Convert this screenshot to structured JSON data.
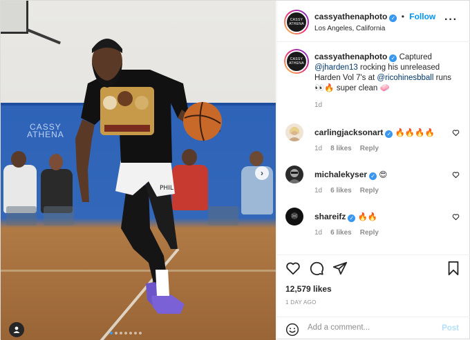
{
  "photo": {
    "watermark_line1": "CASSY",
    "watermark_line2": "ATHENA",
    "shirt_text": "PHIL",
    "carousel_dots": 7,
    "carousel_active_index": 0,
    "next_icon": "chevron-right-icon",
    "tag_icon": "user-tag-icon"
  },
  "header": {
    "avatar_line1": "CASSY",
    "avatar_line2": "ATHENA",
    "username": "cassyathenaphoto",
    "verified_glyph": "✓",
    "separator": "•",
    "follow_label": "Follow",
    "location": "Los Angeles, California",
    "more_icon": "more-options-icon",
    "more_glyph": "···"
  },
  "caption": {
    "username": "cassyathenaphoto",
    "text_1": " Captured ",
    "mention_1": "@jharden13",
    "text_2": " rocking his unreleased Harden Vol 7's at ",
    "mention_2": "@ricohinesbball",
    "text_3": " runs 👀🔥 super clean 🧼",
    "time": "1d"
  },
  "comments": [
    {
      "username": "carlingjacksonart",
      "verified": true,
      "text": "🔥🔥🔥🔥",
      "time": "1d",
      "likes": "8 likes",
      "reply": "Reply"
    },
    {
      "username": "michalekyser",
      "verified": true,
      "text": "😍",
      "time": "1d",
      "likes": "6 likes",
      "reply": "Reply"
    },
    {
      "username": "shareifz",
      "verified": true,
      "text": "🔥🔥",
      "time": "1d",
      "likes": "6 likes",
      "reply": "Reply"
    }
  ],
  "actions": {
    "like_icon": "heart-icon",
    "comment_icon": "comment-icon",
    "share_icon": "share-icon",
    "save_icon": "bookmark-icon",
    "likes": "12,579 likes",
    "date": "1 DAY AGO"
  },
  "add_comment": {
    "emoji_icon": "emoji-icon",
    "placeholder": "Add a comment...",
    "post_label": "Post"
  },
  "colors": {
    "accent": "#0095f6",
    "verified": "#3897f0",
    "post_disabled": "#b2dffc",
    "muted": "#8e8e8e",
    "text": "#262626"
  }
}
